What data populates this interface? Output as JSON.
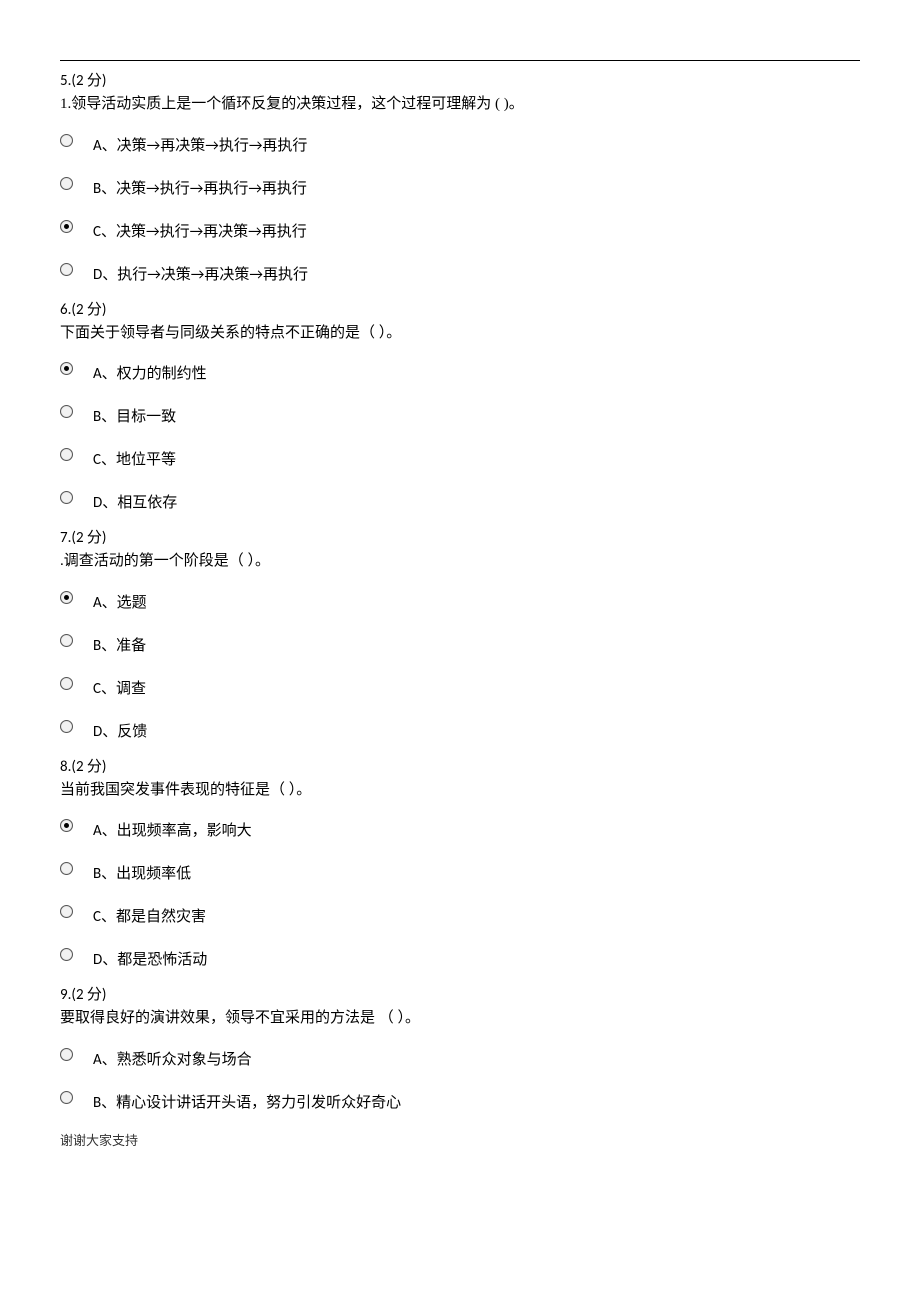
{
  "questions": [
    {
      "header": "5.(2 分)",
      "text": "1.领导活动实质上是一个循环反复的决策过程，这个过程可理解为 ( )。",
      "options": [
        {
          "label": "A、决策→再决策→执行→再执行",
          "selected": false
        },
        {
          "label": "B、决策→执行→再执行→再执行",
          "selected": false
        },
        {
          "label": "C、决策→执行→再决策→再执行",
          "selected": true
        },
        {
          "label": "D、执行→决策→再决策→再执行",
          "selected": false
        }
      ]
    },
    {
      "header": "6.(2 分)",
      "text": "下面关于领导者与同级关系的特点不正确的是（ ）。",
      "options": [
        {
          "label": "A、权力的制约性",
          "selected": true
        },
        {
          "label": "B、目标一致",
          "selected": false
        },
        {
          "label": "C、地位平等",
          "selected": false
        },
        {
          "label": "D、相互依存",
          "selected": false
        }
      ]
    },
    {
      "header": "7.(2 分)",
      "text": ".调查活动的第一个阶段是（ ）。",
      "options": [
        {
          "label": "A、选题",
          "selected": true
        },
        {
          "label": "B、准备",
          "selected": false
        },
        {
          "label": "C、调查",
          "selected": false
        },
        {
          "label": "D、反馈",
          "selected": false
        }
      ]
    },
    {
      "header": "8.(2 分)",
      "text": "当前我国突发事件表现的特征是（ ）。",
      "options": [
        {
          "label": "A、出现频率高，影响大",
          "selected": true
        },
        {
          "label": "B、出现频率低",
          "selected": false
        },
        {
          "label": "C、都是自然灾害",
          "selected": false
        },
        {
          "label": "D、都是恐怖活动",
          "selected": false
        }
      ]
    },
    {
      "header": "9.(2 分)",
      "text": "要取得良好的演讲效果，领导不宜采用的方法是 （ ）。",
      "options": [
        {
          "label": "A、熟悉听众对象与场合",
          "selected": false
        },
        {
          "label": "B、精心设计讲话开头语，努力引发听众好奇心",
          "selected": false
        }
      ]
    }
  ],
  "footer": "谢谢大家支持"
}
